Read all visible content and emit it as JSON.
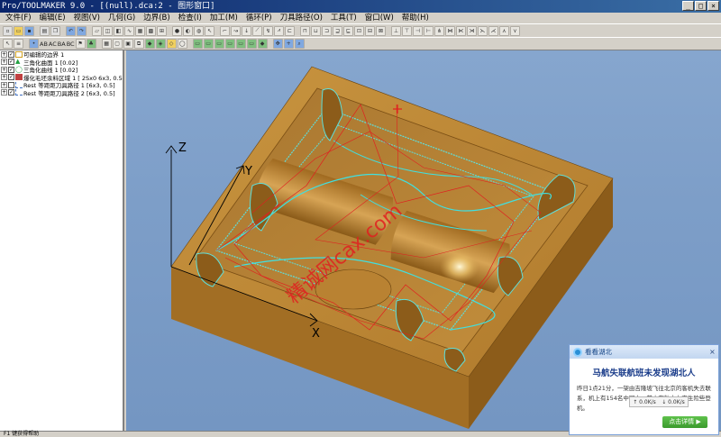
{
  "window": {
    "title": "Pro/TOOLMAKER 9.0 - [(null).dca:2 - 图形窗口]",
    "controls": [
      "_",
      "□",
      "×"
    ]
  },
  "menu": {
    "items": [
      "文件(F)",
      "编辑(E)",
      "视图(V)",
      "几何(G)",
      "边界(B)",
      "检查(I)",
      "加工(M)",
      "循环(P)",
      "刀具路径(O)",
      "工具(T)",
      "窗口(W)",
      "帮助(H)"
    ]
  },
  "toolbar": {
    "text_labels": [
      "AB",
      "AC",
      "BA",
      "BC"
    ]
  },
  "tree": {
    "items": [
      {
        "expander": "+",
        "checked": true,
        "icon": "boundary-icon",
        "label": "可编辑的边界 1",
        "color": "#d0a020"
      },
      {
        "expander": "+",
        "checked": true,
        "icon": "triangle-surface-icon",
        "label": "三角化曲面 1 [0.02]",
        "color": "#20a040"
      },
      {
        "expander": "+",
        "checked": true,
        "icon": "triangle-curve-icon",
        "label": "三角化曲线 1 [0.02]",
        "color": "#20a040"
      },
      {
        "expander": "+",
        "checked": true,
        "icon": "residual-region-icon",
        "label": "爆化毛坯余料区域 1 [ 2Sx0 6x3, 0.5",
        "color": "#c04040"
      },
      {
        "expander": "+",
        "checked": false,
        "icon": "toolpath-icon",
        "label": "Rest 等距距刀具路径 1 [6x3, 0.5]",
        "color": "#4070c0"
      },
      {
        "expander": "+",
        "checked": true,
        "icon": "toolpath-icon",
        "label": "Rest 等距距刀具路径 2 [6x3, 0.5]",
        "color": "#4070c0"
      }
    ]
  },
  "viewport": {
    "axes": {
      "x": "X",
      "y": "Y",
      "z": "Z"
    },
    "watermark": "精诚网cax.com"
  },
  "statusbar": {
    "text": "F1 键获得帮助"
  },
  "popup": {
    "title": "看看湖北",
    "close": "×",
    "headline": "马航失联航班未发现湖北人",
    "body": "昨日1点21分，一架由吉隆坡飞往北京的客机失去联系，机上有154名中国人，其中有数十七李生险些登机。",
    "speed_up": "0.0K/s",
    "speed_down": "0.0K/s",
    "button": "点击详情 ▶"
  },
  "colors": {
    "title_start": "#0a246a",
    "title_end": "#3a6ea5",
    "viewport_bg": "#7d9ec8",
    "part_top": "#c08a34",
    "part_side": "#a06d22",
    "toolpath_cyan": "#40e0e0",
    "rapid_red": "#e02020"
  }
}
